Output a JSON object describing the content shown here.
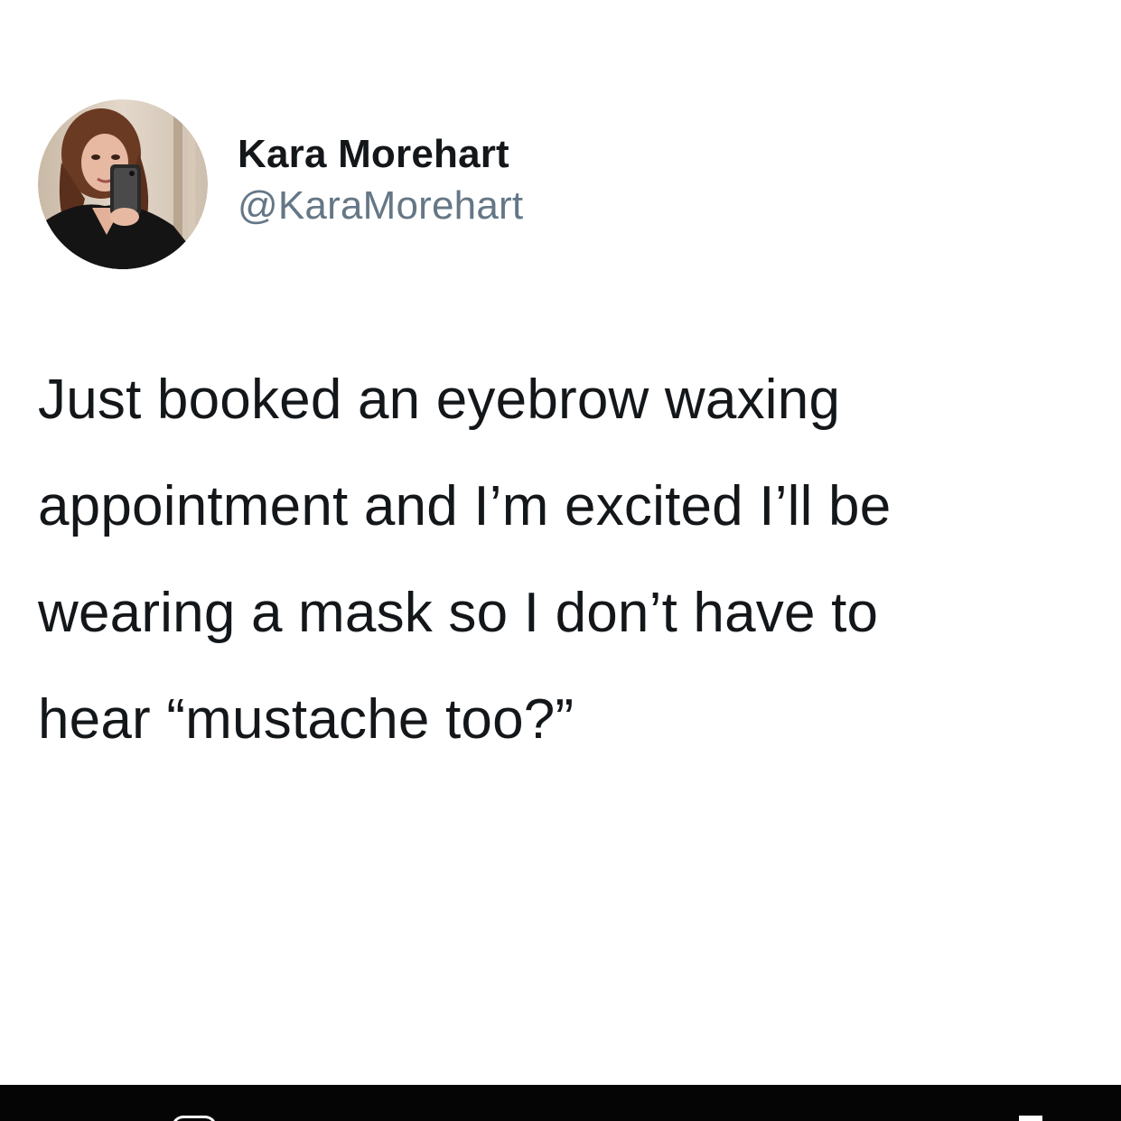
{
  "tweet": {
    "display_name": "Kara Morehart",
    "handle": "@KaraMorehart",
    "avatar_icon": "profile-photo-icon",
    "text_lines": [
      "Just booked an eyebrow waxing",
      "appointment and I’m excited I’ll be",
      "wearing a mask so I don’t have to",
      "hear “mustache too?”"
    ]
  },
  "colors": {
    "background": "#ffffff",
    "text_primary": "#14171a",
    "text_secondary": "#657786",
    "bottom_bar": "#050505"
  }
}
